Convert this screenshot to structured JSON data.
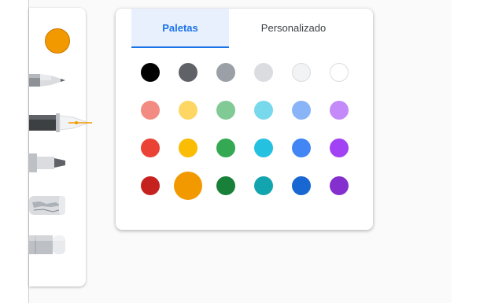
{
  "tabs": {
    "paletas": "Paletas",
    "personalizado": "Personalizado"
  },
  "current_color": "#f29900",
  "tools": [
    "pencil-icon",
    "fountain-pen-icon",
    "marker-icon",
    "chalk-icon",
    "eraser-icon"
  ],
  "selected_tool": "fountain-pen-icon",
  "palette": {
    "selected_color": "#f29900",
    "rows": [
      [
        "#000000",
        "#5f6368",
        "#9aa0a6",
        "#dadce0",
        "#f1f3f4",
        "#ffffff"
      ],
      [
        "#f28b82",
        "#fdd663",
        "#81c995",
        "#78d9ec",
        "#8ab4f8",
        "#c58af9"
      ],
      [
        "#ea4335",
        "#fbbc04",
        "#34a853",
        "#24c1e0",
        "#4285f4",
        "#a142f4"
      ],
      [
        "#c5221f",
        "#f29900",
        "#188038",
        "#12a4af",
        "#1967d2",
        "#8430ce"
      ]
    ]
  }
}
